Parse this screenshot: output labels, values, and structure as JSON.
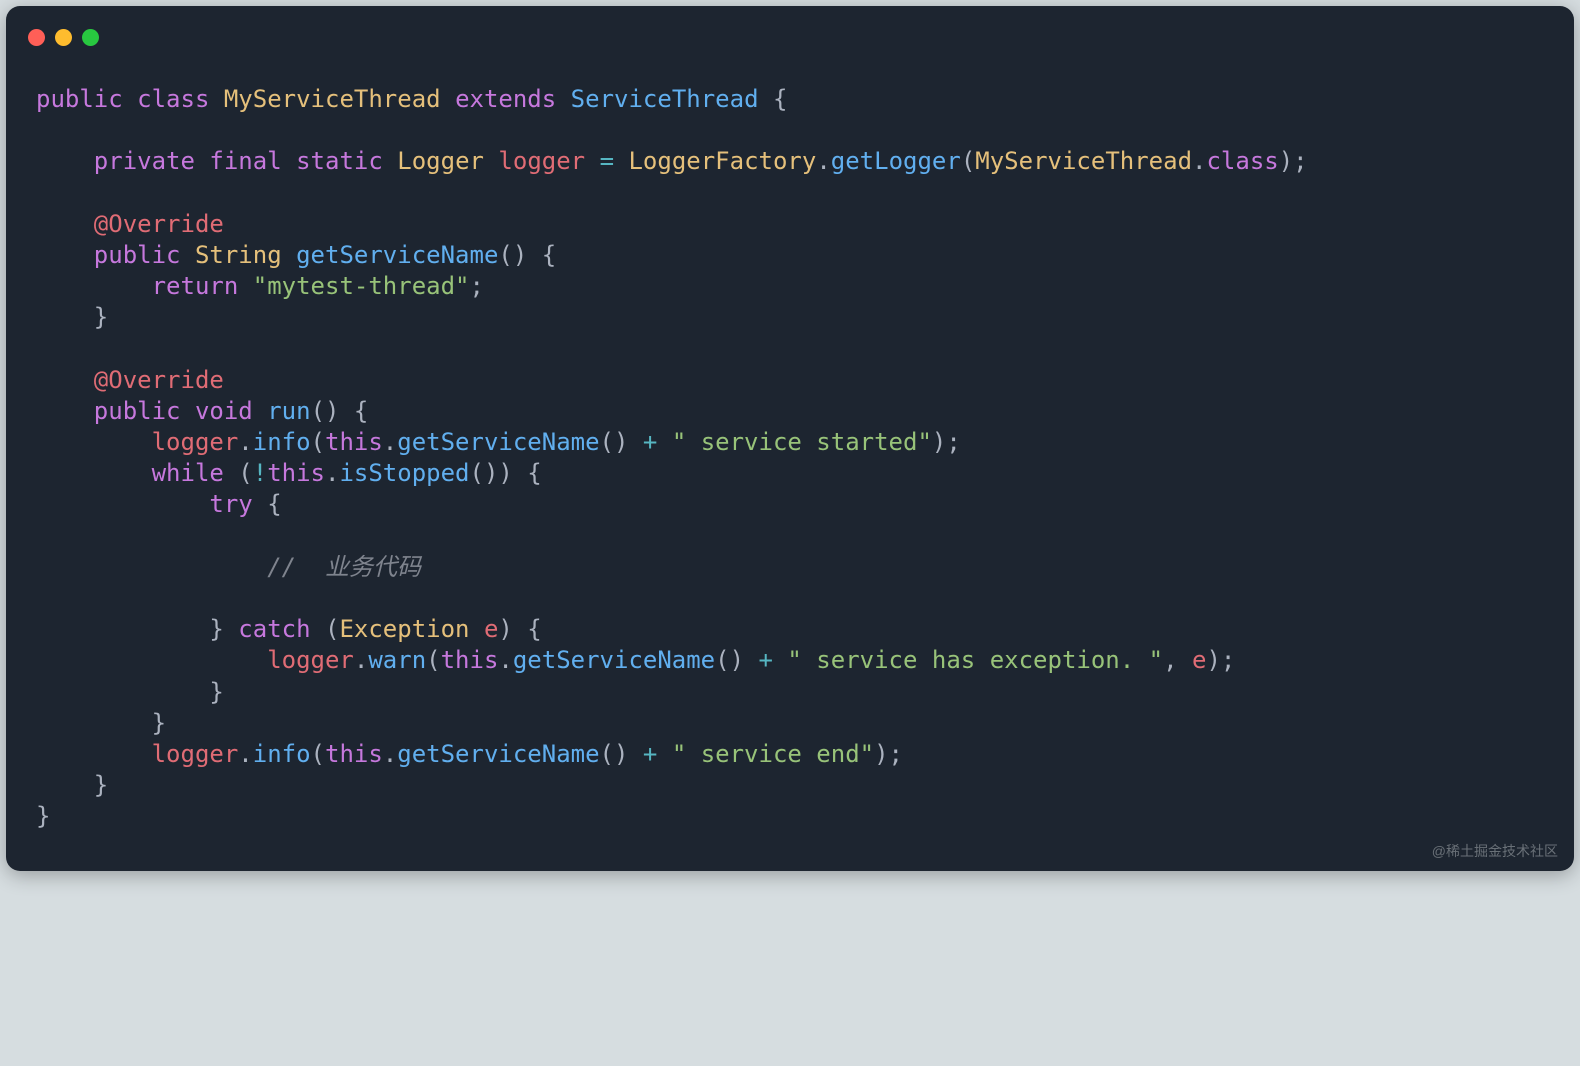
{
  "code": {
    "line1_public": "public",
    "line1_class": "class",
    "line1_classname": "MyServiceThread",
    "line1_extends": "extends",
    "line1_parent": "ServiceThread",
    "line3_private": "private",
    "line3_final": "final",
    "line3_static": "static",
    "line3_type": "Logger",
    "line3_var": "logger",
    "line3_factory": "LoggerFactory",
    "line3_getlogger": "getLogger",
    "line3_arg": "MyServiceThread",
    "line3_classkw": "class",
    "line5_override": "@Override",
    "line6_public": "public",
    "line6_type": "String",
    "line6_method": "getServiceName",
    "line7_return": "return",
    "line7_str": "\"mytest-thread\"",
    "line10_override": "@Override",
    "line11_public": "public",
    "line11_void": "void",
    "line11_run": "run",
    "line12_logger": "logger",
    "line12_info": "info",
    "line12_this": "this",
    "line12_gsn": "getServiceName",
    "line12_str": "\" service started\"",
    "line13_while": "while",
    "line13_this": "this",
    "line13_isstopped": "isStopped",
    "line14_try": "try",
    "line16_comment": "//  业务代码",
    "line18_catch": "catch",
    "line18_exc": "Exception",
    "line18_e": "e",
    "line19_logger": "logger",
    "line19_warn": "warn",
    "line19_this": "this",
    "line19_gsn": "getServiceName",
    "line19_str": "\" service has exception. \"",
    "line19_e": "e",
    "line22_logger": "logger",
    "line22_info": "info",
    "line22_this": "this",
    "line22_gsn": "getServiceName",
    "line22_str": "\" service end\""
  },
  "watermark": "@稀土掘金技术社区"
}
